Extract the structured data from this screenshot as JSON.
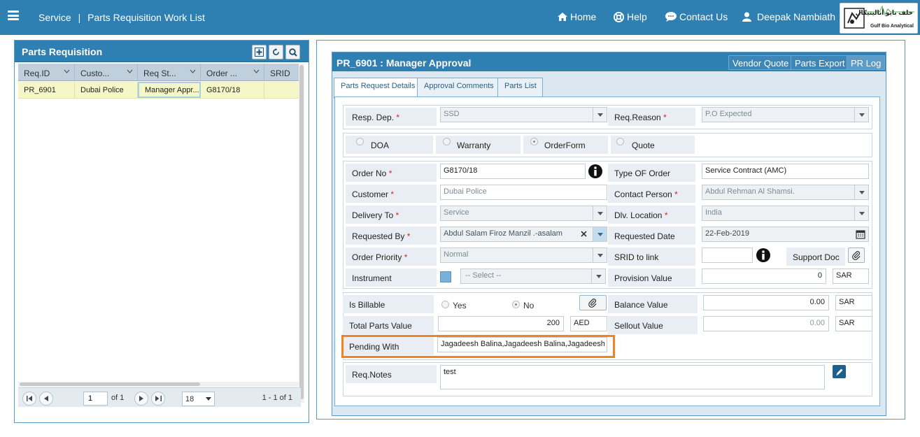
{
  "header": {
    "breadcrumb_root": "Service",
    "breadcrumb_separator": "|",
    "breadcrumb_page": "Parts Requisition Work List",
    "nav": {
      "home": "Home",
      "help": "Help",
      "contact": "Contact Us",
      "user": "Deepak Nambiath"
    },
    "logo": {
      "text_en": "Gulf Bio Analytical",
      "text_ar": "خلف بايو أناليتيكال"
    },
    "bar_color": "#2e7fb2"
  },
  "left_panel": {
    "title": "Parts Requisition",
    "columns": [
      "Req.ID",
      "Custo...",
      "Req St...",
      "Order ...",
      "SRID"
    ],
    "rows": [
      {
        "req_id": "PR_6901",
        "customer": "Dubai Police",
        "status": "Manager Appr...",
        "order": "G8170/18",
        "srid": ""
      }
    ],
    "pager": {
      "page": "1",
      "of_text": "of 1",
      "page_size": "18",
      "range": "1 - 1 of 1"
    }
  },
  "detail": {
    "title": "PR_6901 : Manager Approval",
    "buttons": {
      "vendor_quote": "Vendor Quote",
      "parts_export": "Parts Export",
      "pr_log": "PR Log"
    },
    "tabs": [
      "Parts Request Details",
      "Approval Comments",
      "Parts List"
    ],
    "fields": {
      "resp_dep_label": "Resp. Dep.",
      "resp_dep": "SSD",
      "req_reason_label": "Req.Reason",
      "req_reason": "P.O Expected",
      "order_types": [
        "DOA",
        "Warranty",
        "OrderForm",
        "Quote"
      ],
      "order_no_label": "Order No",
      "order_no": "G8170/18",
      "type_of_order_label": "Type OF Order",
      "type_of_order": "Service Contract (AMC)",
      "customer_label": "Customer",
      "customer": "Dubai Police",
      "contact_person_label": "Contact Person",
      "contact_person": "Abdul Rehman Al Shamsi.",
      "delivery_to_label": "Delivery To",
      "delivery_to": "Service",
      "dlv_location_label": "Dlv. Location",
      "dlv_location": "India",
      "requested_by_label": "Requested By",
      "requested_by": "Abdul Salam Firoz Manzil .-asalam",
      "requested_date_label": "Requested Date",
      "requested_date": "22-Feb-2019",
      "order_priority_label": "Order Priority",
      "order_priority": "Normal",
      "srid_label": "SRID to link",
      "srid": "",
      "support_doc_label": "Support Doc",
      "instrument_label": "Instrument",
      "instrument": "-- Select --",
      "provision_value_label": "Provision Value",
      "provision_value": "0",
      "provision_currency": "SAR",
      "is_billable_label": "Is Billable",
      "billable_yes": "Yes",
      "billable_no": "No",
      "balance_value_label": "Balance Value",
      "balance_value": "0.00",
      "balance_currency": "SAR",
      "total_parts_label": "Total Parts Value",
      "total_parts": "200",
      "total_currency": "AED",
      "sellout_value_label": "Sellout Value",
      "sellout_value": "0.00",
      "sellout_currency": "SAR",
      "pending_with_label": "Pending With",
      "pending_with": "Jagadeesh Balina,Jagadeesh Balina,Jagadeesh Ba",
      "req_notes_label": "Req.Notes",
      "req_notes": "test"
    },
    "required_marker": "*",
    "highlight_color": "#f08323"
  }
}
